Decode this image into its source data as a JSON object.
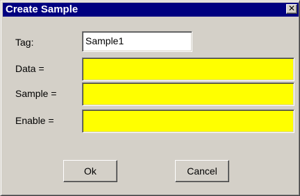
{
  "dialog": {
    "title": "Create Sample",
    "close_glyph": "✕"
  },
  "fields": {
    "tag": {
      "label": "Tag:",
      "value": "Sample1"
    },
    "data": {
      "label": "Data =",
      "value": ""
    },
    "sample": {
      "label": "Sample =",
      "value": ""
    },
    "enable": {
      "label": "Enable =",
      "value": ""
    }
  },
  "buttons": {
    "ok": "Ok",
    "cancel": "Cancel"
  },
  "colors": {
    "titlebar": "#000080",
    "field_highlight": "#ffff00",
    "face": "#d4d0c8"
  },
  "icons": {
    "close": "close-icon"
  }
}
